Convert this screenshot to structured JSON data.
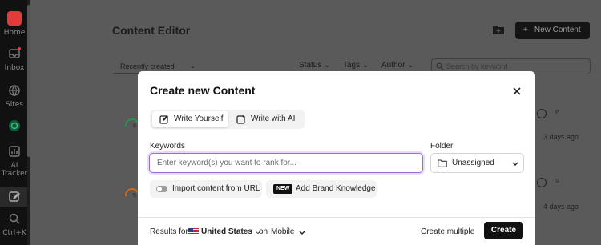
{
  "rail": {
    "items": [
      {
        "label": "Home",
        "icon": "home-icon",
        "accent": "#e23b3b"
      },
      {
        "label": "Inbox",
        "icon": "inbox-icon"
      },
      {
        "label": "Sites",
        "icon": "globe-icon"
      },
      {
        "label": "",
        "icon": "site-favicon-icon"
      },
      {
        "label": "AI Tracker",
        "icon": "ai-tracker-icon"
      },
      {
        "label": "",
        "icon": "editor-icon"
      },
      {
        "label": "Ctrl+K",
        "icon": "search-icon"
      }
    ]
  },
  "page": {
    "title": "Content Editor",
    "new_content_label": "New Content",
    "sort_label": "Recently created",
    "filters": {
      "status": "Status",
      "tags": "Tags",
      "author": "Author"
    },
    "search_placeholder": "Search by keyword",
    "rows": [
      {
        "date": "3 days ago",
        "avatar": "P",
        "score": "8"
      },
      {
        "date": "4 days ago",
        "avatar": "S",
        "score": "5"
      }
    ]
  },
  "modal": {
    "title": "Create new Content",
    "tabs": {
      "write_yourself": "Write Yourself",
      "write_ai": "Write with AI"
    },
    "keywords_label": "Keywords",
    "keywords_placeholder": "Enter keyword(s) you want to rank for...",
    "folder_label": "Folder",
    "folder_value": "Unassigned",
    "import_label": "Import content from URL",
    "brand_badge": "NEW",
    "brand_label": "Add Brand Knowledge",
    "footer": {
      "results_for": "Results for",
      "country": "United States",
      "on": "on",
      "device": "Mobile",
      "create_multiple": "Create multiple",
      "create": "Create"
    }
  },
  "colors": {
    "focus": "#9a6ccf",
    "primary": "#111111"
  }
}
